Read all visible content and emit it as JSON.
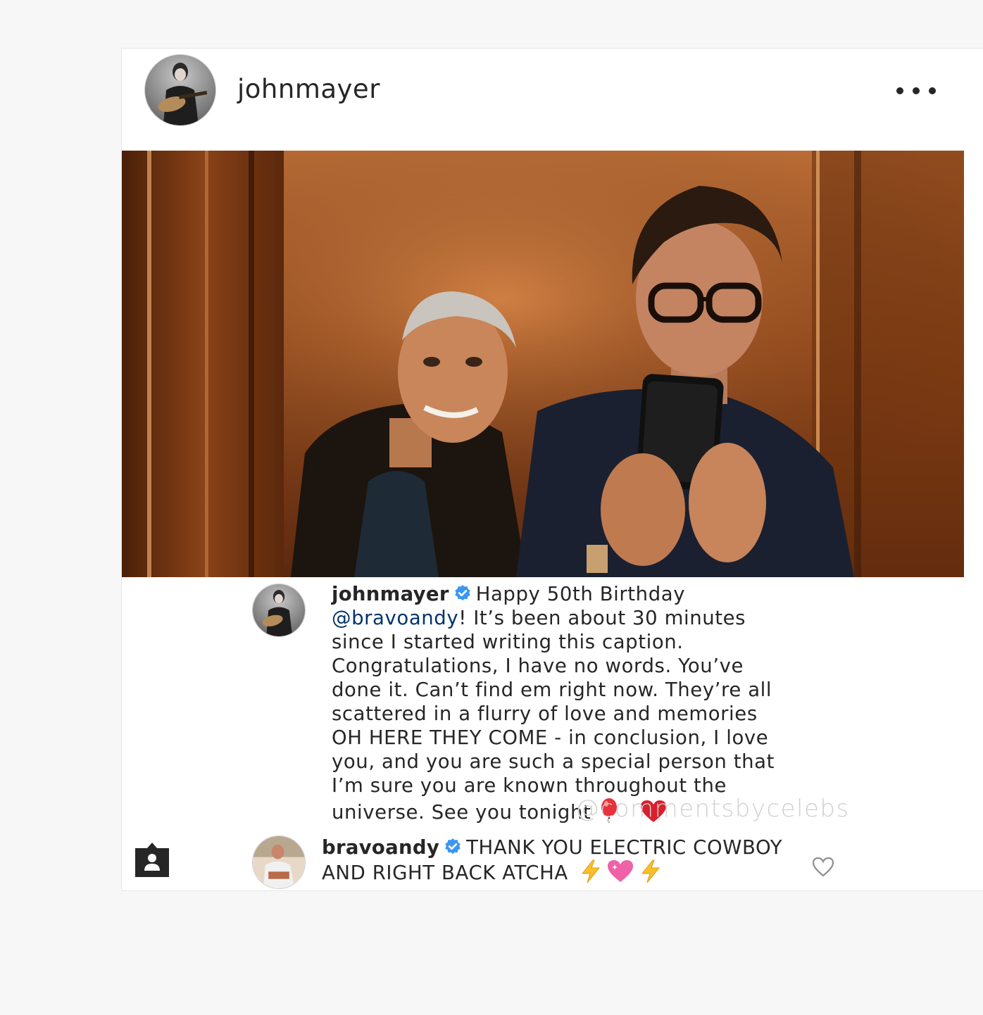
{
  "post": {
    "username": "johnmayer",
    "more_icon": "more-horizontal-icon"
  },
  "caption": {
    "username": "johnmayer",
    "verified_icon": "verified-badge-icon",
    "text_before_mention": "Happy 50th Birthday",
    "mention": "@bravoandy",
    "text_after_mention": "! It’s been about 30 minutes since I started writing this caption. Congratulations, I have no words. You’ve done it. Can’t find em right now. They’re all scattered in a flurry of love and memories OH HERE THEY COME - in conclusion, I love you, and you are such a special person that I’m sure you are known throughout the universe. See you tonight",
    "emojis": [
      "balloon",
      "red-heart"
    ]
  },
  "watermark": "@commentsbycelebs",
  "comment": {
    "username": "bravoandy",
    "verified_icon": "verified-badge-icon",
    "text": "THANK YOU ELECTRIC COWBOY AND RIGHT BACK ATCHA",
    "emojis": [
      "high-voltage",
      "sparkling-heart",
      "high-voltage"
    ],
    "like_icon": "heart-outline-icon"
  },
  "colors": {
    "verified_blue": "#3897f0",
    "mention_blue": "#003569",
    "text": "#262626",
    "watermark": "#d0d0d0",
    "page_bg": "#f7f7f7"
  }
}
